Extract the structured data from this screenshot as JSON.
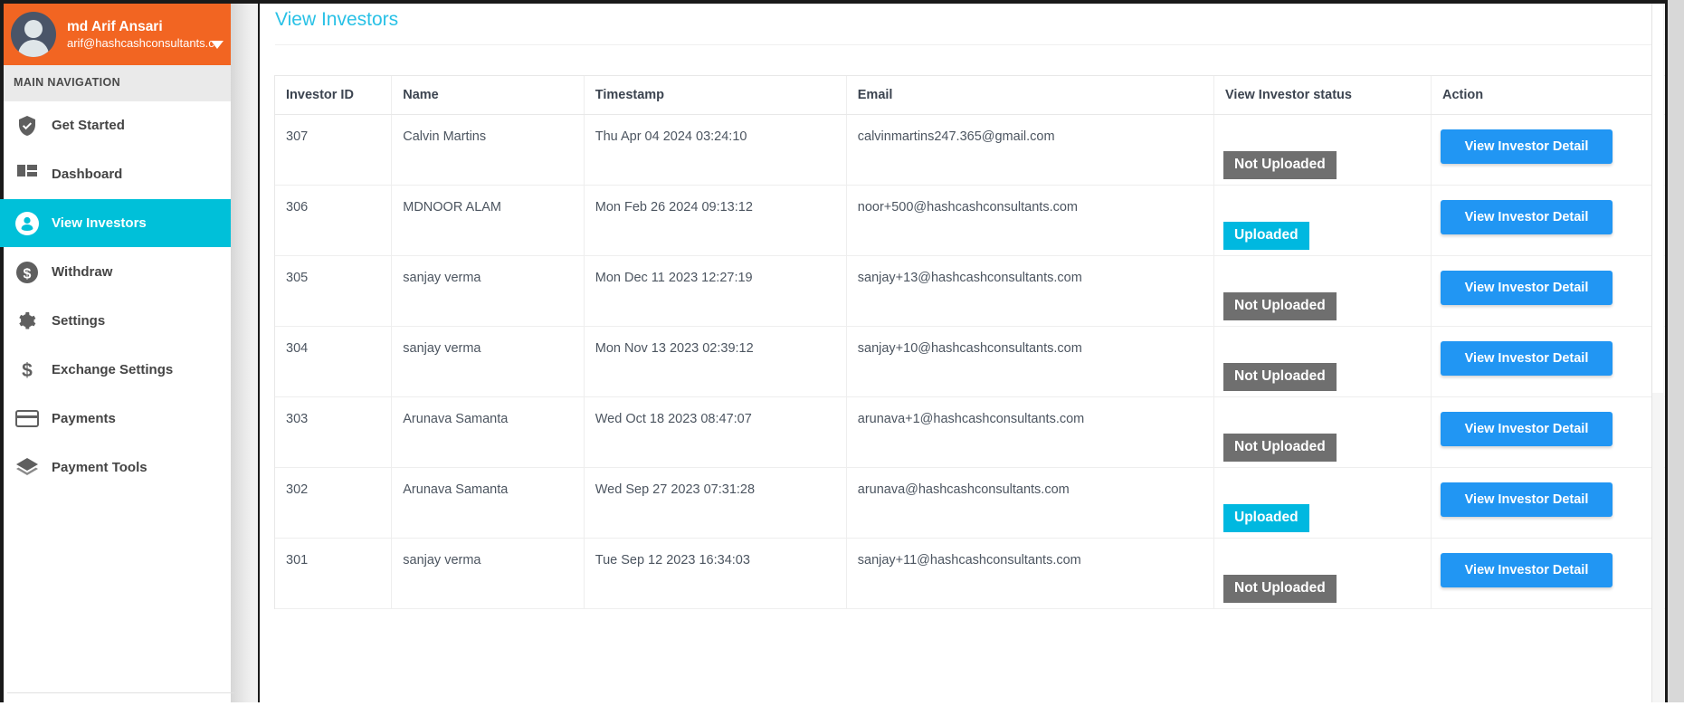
{
  "sidebar": {
    "user": {
      "name": "md Arif Ansari",
      "email": "arif@hashcashconsultants.c",
      "avatar_icon": "user-avatar-icon",
      "caret_icon": "caret-down-icon"
    },
    "nav_header": "MAIN NAVIGATION",
    "items": [
      {
        "label": "Get Started",
        "icon": "shield-check-icon",
        "active": false
      },
      {
        "label": "Dashboard",
        "icon": "dashboard-grid-icon",
        "active": false
      },
      {
        "label": "View Investors",
        "icon": "user-circle-icon",
        "active": true
      },
      {
        "label": "Withdraw",
        "icon": "dollar-circle-icon",
        "active": false
      },
      {
        "label": "Settings",
        "icon": "gear-icon",
        "active": false
      },
      {
        "label": "Exchange Settings",
        "icon": "dollar-sign-icon",
        "active": false
      },
      {
        "label": "Payments",
        "icon": "credit-card-icon",
        "active": false
      },
      {
        "label": "Payment Tools",
        "icon": "layers-icon",
        "active": false
      }
    ]
  },
  "main": {
    "page_title": "View Investors",
    "table": {
      "columns": [
        "Investor ID",
        "Name",
        "Timestamp",
        "Email",
        "View Investor status",
        "Action"
      ],
      "action_label": "View Investor Detail",
      "rows": [
        {
          "id": "307",
          "name": "Calvin Martins",
          "timestamp": "Thu Apr 04 2024 03:24:10",
          "email": "calvinmartins247.365@gmail.com",
          "status": "Not Uploaded",
          "status_type": "not-uploaded",
          "action": "View Investor Detail"
        },
        {
          "id": "306",
          "name": "MDNOOR ALAM",
          "timestamp": "Mon Feb 26 2024 09:13:12",
          "email": "noor+500@hashcashconsultants.com",
          "status": "Uploaded",
          "status_type": "uploaded",
          "action": "View Investor Detail"
        },
        {
          "id": "305",
          "name": "sanjay verma",
          "timestamp": "Mon Dec 11 2023 12:27:19",
          "email": "sanjay+13@hashcashconsultants.com",
          "status": "Not Uploaded",
          "status_type": "not-uploaded",
          "action": "View Investor Detail"
        },
        {
          "id": "304",
          "name": "sanjay verma",
          "timestamp": "Mon Nov 13 2023 02:39:12",
          "email": "sanjay+10@hashcashconsultants.com",
          "status": "Not Uploaded",
          "status_type": "not-uploaded",
          "action": "View Investor Detail"
        },
        {
          "id": "303",
          "name": "Arunava Samanta",
          "timestamp": "Wed Oct 18 2023 08:47:07",
          "email": "arunava+1@hashcashconsultants.com",
          "status": "Not Uploaded",
          "status_type": "not-uploaded",
          "action": "View Investor Detail"
        },
        {
          "id": "302",
          "name": "Arunava Samanta",
          "timestamp": "Wed Sep 27 2023 07:31:28",
          "email": "arunava@hashcashconsultants.com",
          "status": "Uploaded",
          "status_type": "uploaded",
          "action": "View Investor Detail"
        },
        {
          "id": "301",
          "name": "sanjay verma",
          "timestamp": "Tue Sep 12 2023 16:34:03",
          "email": "sanjay+11@hashcashconsultants.com",
          "status": "Not Uploaded",
          "status_type": "not-uploaded",
          "action": "View Investor Detail"
        }
      ]
    }
  },
  "colors": {
    "user_panel_bg": "#f26522",
    "active_nav_bg": "#00c0d9",
    "page_title": "#29c1e6",
    "badge_not_uploaded": "#6f6f6f",
    "badge_uploaded": "#00b8e0",
    "action_button": "#2196f3"
  }
}
